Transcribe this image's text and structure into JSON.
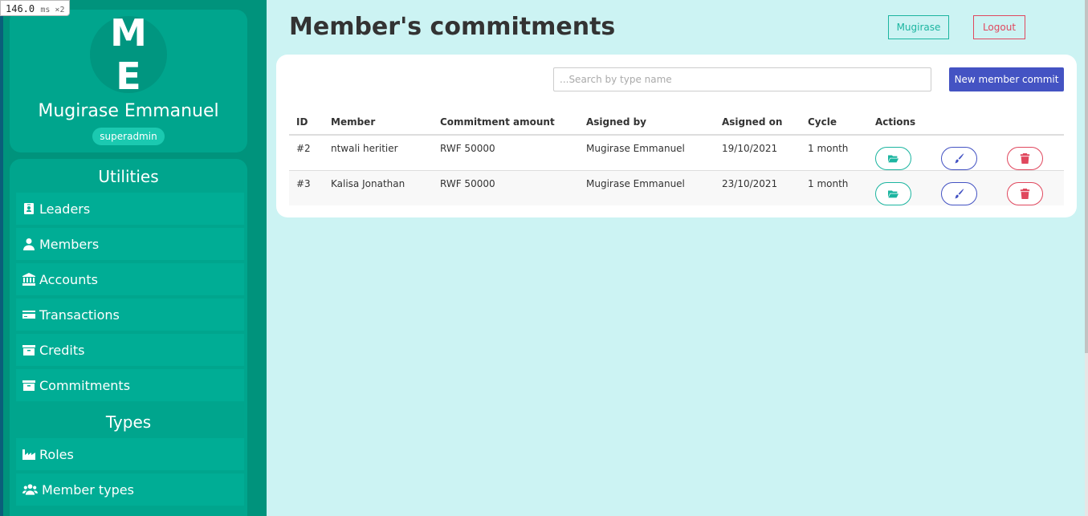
{
  "perf": {
    "value": "146.0",
    "unit": "ms ×2"
  },
  "profile": {
    "initials": "M E",
    "name": "Mugirase Emmanuel",
    "role": "superadmin"
  },
  "sidebar": {
    "utilities_title": "Utilities",
    "utilities": [
      {
        "label": "Leaders",
        "icon": "id-badge-icon"
      },
      {
        "label": "Members",
        "icon": "user-icon"
      },
      {
        "label": "Accounts",
        "icon": "bank-icon"
      },
      {
        "label": "Transactions",
        "icon": "credit-card-icon"
      },
      {
        "label": "Credits",
        "icon": "archive-icon"
      },
      {
        "label": "Commitments",
        "icon": "archive-icon"
      }
    ],
    "types_title": "Types",
    "types": [
      {
        "label": "Roles",
        "icon": "industry-icon"
      },
      {
        "label": "Member types",
        "icon": "users-icon"
      }
    ]
  },
  "header": {
    "title": "Member's commitments",
    "user_button": "Mugirase",
    "logout_button": "Logout"
  },
  "toolbar": {
    "search_placeholder": "...Search by type name",
    "search_value": "",
    "new_button": "New member commit"
  },
  "table": {
    "columns": [
      "ID",
      "Member",
      "Commitment amount",
      "Asigned by",
      "Asigned on",
      "Cycle",
      "Actions"
    ],
    "rows": [
      {
        "id": "#2",
        "member": "ntwali heritier",
        "amount": "RWF 50000",
        "assigned_by": "Mugirase Emmanuel",
        "assigned_on": "19/10/2021",
        "cycle": "1 month"
      },
      {
        "id": "#3",
        "member": "Kalisa Jonathan",
        "amount": "RWF 50000",
        "assigned_by": "Mugirase Emmanuel",
        "assigned_on": "23/10/2021",
        "cycle": "1 month"
      }
    ]
  },
  "colors": {
    "sidebar_bg": "#00937c",
    "card_bg": "#00a58d",
    "page_bg": "#ccf3f3",
    "primary": "#4453c3",
    "success": "#1cb5a0",
    "danger": "#e0485e"
  }
}
